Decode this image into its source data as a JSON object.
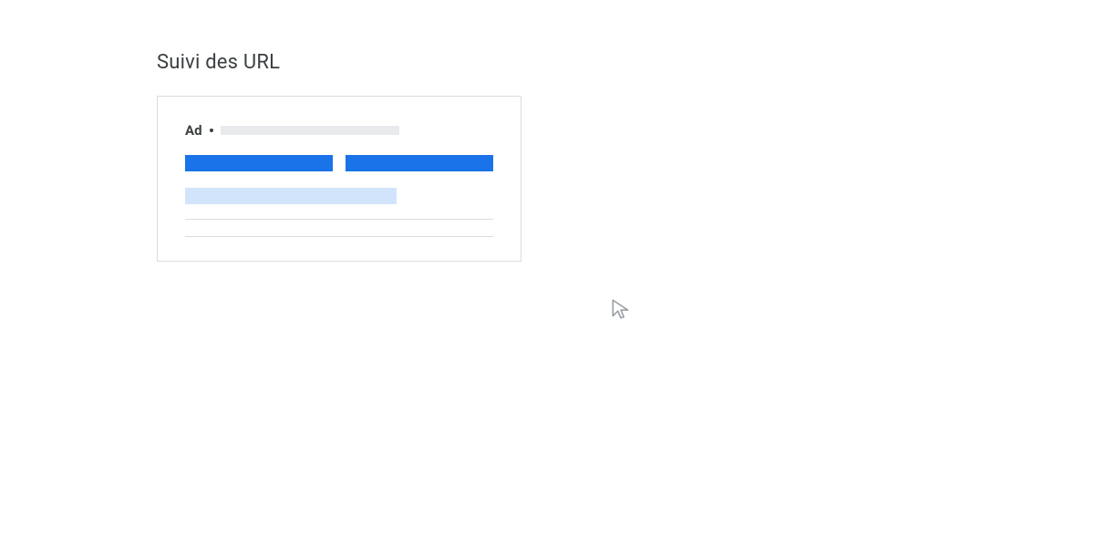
{
  "heading": "Suivi des URL",
  "ad_label": "Ad",
  "colors": {
    "text": "#3c4043",
    "border": "#dadce0",
    "placeholder_gray": "#e8eaed",
    "title_blue": "#1a73e8",
    "desc_light_blue": "#d2e3fc",
    "cursor_stroke": "#9aa0a6"
  }
}
